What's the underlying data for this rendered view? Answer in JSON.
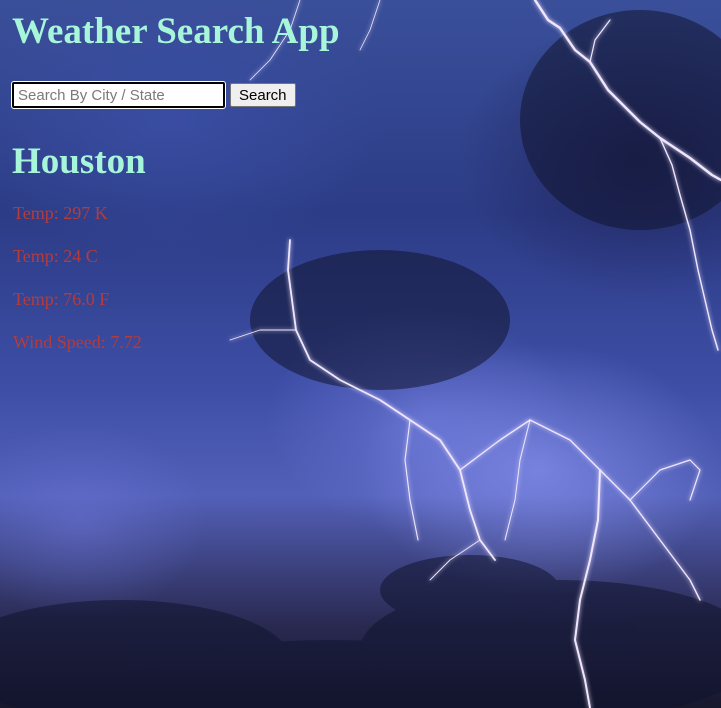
{
  "app": {
    "title": "Weather Search App"
  },
  "search": {
    "placeholder": "Search By City / State",
    "value": "",
    "button_label": "Search"
  },
  "result": {
    "city": "Houston",
    "readings": [
      {
        "label": "Temp: 297 K"
      },
      {
        "label": "Temp: 24 C"
      },
      {
        "label": "Temp: 76.0 F"
      },
      {
        "label": "Wind Speed: 7.72"
      }
    ]
  },
  "colors": {
    "title": "#a7f6da",
    "reading_text": "#b33c3c",
    "background": "#2c3c86"
  },
  "background_image": "lightning-storm-clouds"
}
